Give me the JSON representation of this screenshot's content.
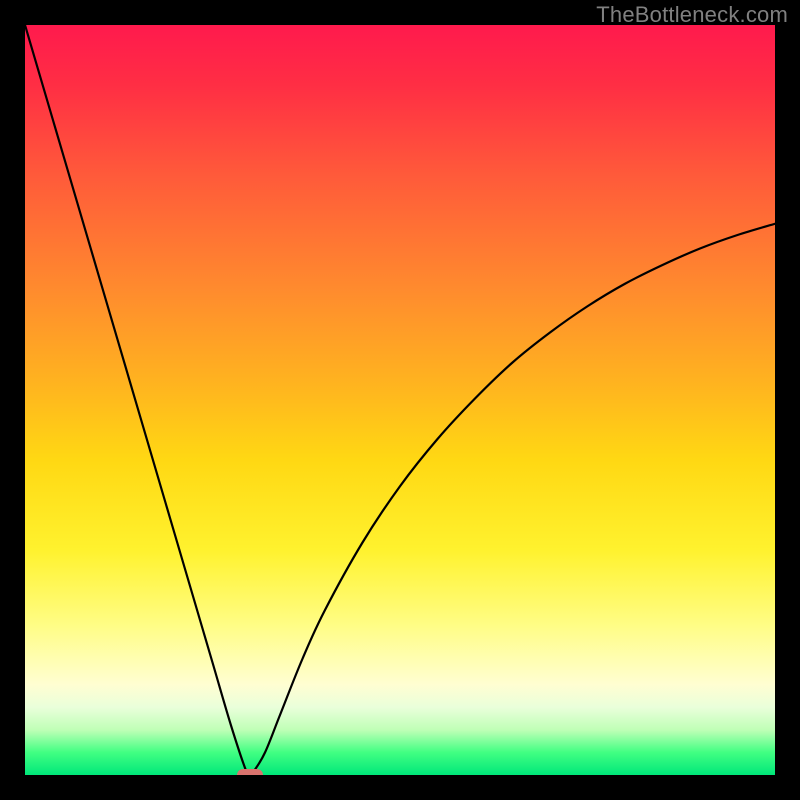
{
  "watermark": "TheBottleneck.com",
  "chart_data": {
    "type": "line",
    "title": "",
    "xlabel": "",
    "ylabel": "",
    "xlim": [
      0,
      100
    ],
    "ylim": [
      0,
      100
    ],
    "grid": false,
    "legend": false,
    "series": [
      {
        "name": "bottleneck-curve",
        "x": [
          0,
          2.5,
          5,
          7.5,
          10,
          12.5,
          15,
          17.5,
          20,
          22.5,
          25,
          27.5,
          29.5,
          30,
          30.5,
          32,
          34,
          37,
          40,
          45,
          50,
          55,
          60,
          65,
          70,
          75,
          80,
          85,
          90,
          95,
          100
        ],
        "values": [
          100,
          91.5,
          83,
          74.5,
          66,
          57.5,
          49,
          40.5,
          32,
          23.5,
          15,
          6.5,
          0.5,
          0,
          0.5,
          3,
          8,
          15.5,
          22,
          31,
          38.5,
          44.8,
          50.2,
          55,
          59,
          62.5,
          65.5,
          68,
          70.2,
          72,
          73.5
        ]
      }
    ],
    "markers": [
      {
        "name": "optimal-point",
        "x": 30,
        "y": 0
      }
    ],
    "colors": {
      "curve": "#000000",
      "marker": "#d9736e",
      "gradient_top": "#ff1a4d",
      "gradient_bottom": "#00e77a"
    }
  }
}
